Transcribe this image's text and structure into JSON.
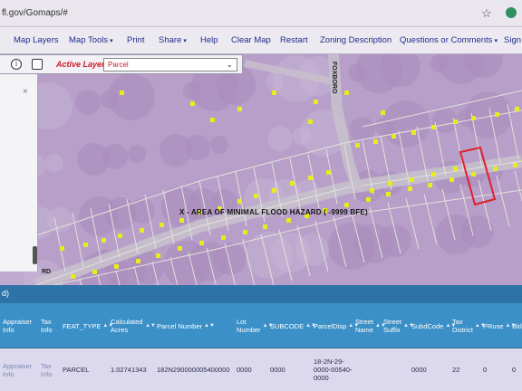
{
  "browser": {
    "url": "fl.gov/Gomaps/#",
    "star_icon": "star-icon",
    "extension_icon": "extension-icon"
  },
  "menu": {
    "items": [
      {
        "label": "Map Layers",
        "has_caret": false
      },
      {
        "label": "Map Tools",
        "has_caret": true
      },
      {
        "label": "Print",
        "has_caret": false
      },
      {
        "label": "Share",
        "has_caret": true
      },
      {
        "label": "Help",
        "has_caret": false
      },
      {
        "label": "Clear Map",
        "has_caret": false
      },
      {
        "label": "Restart",
        "has_caret": false
      },
      {
        "label": "Zoning Description",
        "has_caret": false
      },
      {
        "label": "Questions or Comments",
        "has_caret": true
      },
      {
        "label": "Sign In",
        "has_caret": false
      }
    ],
    "caret": "▾"
  },
  "toolbar": {
    "info_icon": "i",
    "active_layer_label": "Active Layer:",
    "active_layer_value": "Parcel",
    "chevron": "⌄"
  },
  "sidepanel": {
    "close": "×"
  },
  "map": {
    "flood_zone_label": "X - AREA OF MINIMAL FLOOD HAZARD ( -9999 BFE)",
    "street_labels": [
      "FOXBORO",
      "RD"
    ],
    "colors": {
      "parcel_lines": "#e2e2dc",
      "points": "#e8ec1c",
      "selection": "#e0202a",
      "road": "#c8c0cc"
    }
  },
  "results": {
    "header": "d)",
    "sort_icon": "▲▼",
    "columns": [
      {
        "label": "Appraiser Info",
        "sortable": false
      },
      {
        "label": "Tax Info",
        "sortable": false
      },
      {
        "label": "FEAT_TYPE",
        "sortable": true
      },
      {
        "label": "Calculated Acres",
        "sortable": true
      },
      {
        "label": "Parcel Number",
        "sortable": true
      },
      {
        "label": "Lot Number",
        "sortable": true
      },
      {
        "label": "SUBCODE",
        "sortable": true
      },
      {
        "label": "ParcelDisp",
        "sortable": true
      },
      {
        "label": "Street Name",
        "sortable": true
      },
      {
        "label": "Street Suffix",
        "sortable": true
      },
      {
        "label": "SubdCode",
        "sortable": true
      },
      {
        "label": "Tax District",
        "sortable": true
      },
      {
        "label": "PRuse",
        "sortable": true
      },
      {
        "label": "Bld",
        "sortable": false
      }
    ],
    "rows": [
      [
        "Appraiser Info",
        "Tax Info",
        "PARCEL",
        "1.02741343",
        "182N290000005400000",
        "0000",
        "0000",
        "18-2N-29-0000-00540-0000",
        "",
        "",
        "0000",
        "22",
        "0",
        "0"
      ]
    ]
  }
}
